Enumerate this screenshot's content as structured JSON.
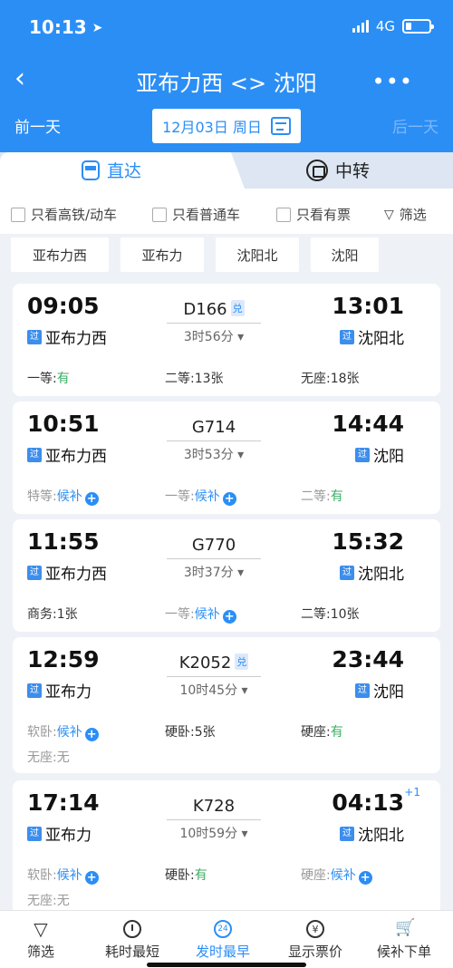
{
  "status": {
    "time": "10:13",
    "network": "4G"
  },
  "header": {
    "title": "亚布力西 <> 沈阳",
    "prev_day": "前一天",
    "next_day": "后一天",
    "date": "12月03日 周日",
    "more": "•••"
  },
  "tabs": [
    {
      "label": "直达"
    },
    {
      "label": "中转"
    }
  ],
  "filters": {
    "high_speed": "只看高铁/动车",
    "normal": "只看普通车",
    "has_ticket": "只看有票",
    "filter": "筛选"
  },
  "stations": [
    "亚布力西",
    "亚布力",
    "沈阳北",
    "沈阳"
  ],
  "pass_tag": "过",
  "dui_tag": "兑",
  "trains": [
    {
      "dep": "09:05",
      "arr": "13:01",
      "no": "D166",
      "duration": "3时56分",
      "from": "亚布力西",
      "to": "沈阳北",
      "seats": [
        {
          "label": "一等:",
          "value": "有"
        },
        {
          "label": "二等:",
          "value": "13张"
        },
        {
          "label": "无座:",
          "value": "18张"
        }
      ]
    },
    {
      "dep": "10:51",
      "arr": "14:44",
      "no": "G714",
      "duration": "3时53分",
      "from": "亚布力西",
      "to": "沈阳",
      "seats": [
        {
          "label": "特等:",
          "value": "候补"
        },
        {
          "label": "一等:",
          "value": "候补"
        },
        {
          "label": "二等:",
          "value": "有"
        }
      ]
    },
    {
      "dep": "11:55",
      "arr": "15:32",
      "no": "G770",
      "duration": "3时37分",
      "from": "亚布力西",
      "to": "沈阳北",
      "seats": [
        {
          "label": "商务:",
          "value": "1张"
        },
        {
          "label": "一等:",
          "value": "候补"
        },
        {
          "label": "二等:",
          "value": "10张"
        }
      ]
    },
    {
      "dep": "12:59",
      "arr": "23:44",
      "no": "K2052",
      "duration": "10时45分",
      "from": "亚布力",
      "to": "沈阳",
      "seats": [
        {
          "label": "软卧:",
          "value": "候补"
        },
        {
          "label": "硬卧:",
          "value": "5张"
        },
        {
          "label": "硬座:",
          "value": "有"
        },
        {
          "label": "无座:",
          "value": "无"
        }
      ]
    },
    {
      "dep": "17:14",
      "arr": "04:13",
      "arr_plus": "+1",
      "no": "K728",
      "duration": "10时59分",
      "from": "亚布力",
      "to": "沈阳北",
      "seats": [
        {
          "label": "软卧:",
          "value": "候补"
        },
        {
          "label": "硬卧:",
          "value": "有"
        },
        {
          "label": "硬座:",
          "value": "候补"
        },
        {
          "label": "无座:",
          "value": "无"
        }
      ]
    }
  ],
  "bottom_nav": [
    {
      "label": "筛选"
    },
    {
      "label": "耗时最短"
    },
    {
      "label": "发时最早"
    },
    {
      "label": "显示票价"
    },
    {
      "label": "候补下单"
    }
  ]
}
